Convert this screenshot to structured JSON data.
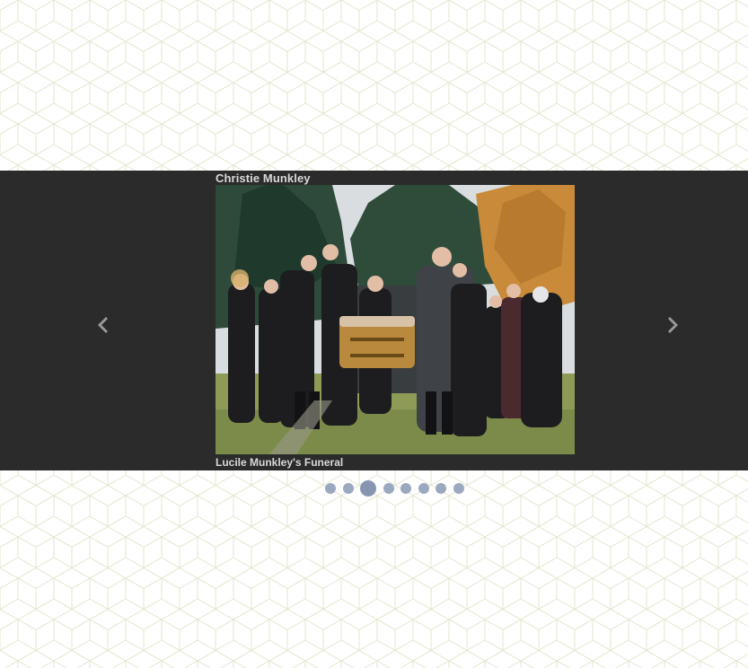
{
  "slideshow": {
    "title": "Christie Munkley",
    "caption": "Lucile Munkley's Funeral",
    "photo_icon": "funeral-photo",
    "prev_icon": "chevron-left-icon",
    "next_icon": "chevron-right-icon",
    "dot_count": 8,
    "active_index": 2
  },
  "colors": {
    "slider_bg": "#2b2b2b",
    "caption_text": "#d8d8d8",
    "dot": "#9aa9c0",
    "dot_active": "#8796b0",
    "pattern_line": "#e4e4cf"
  }
}
